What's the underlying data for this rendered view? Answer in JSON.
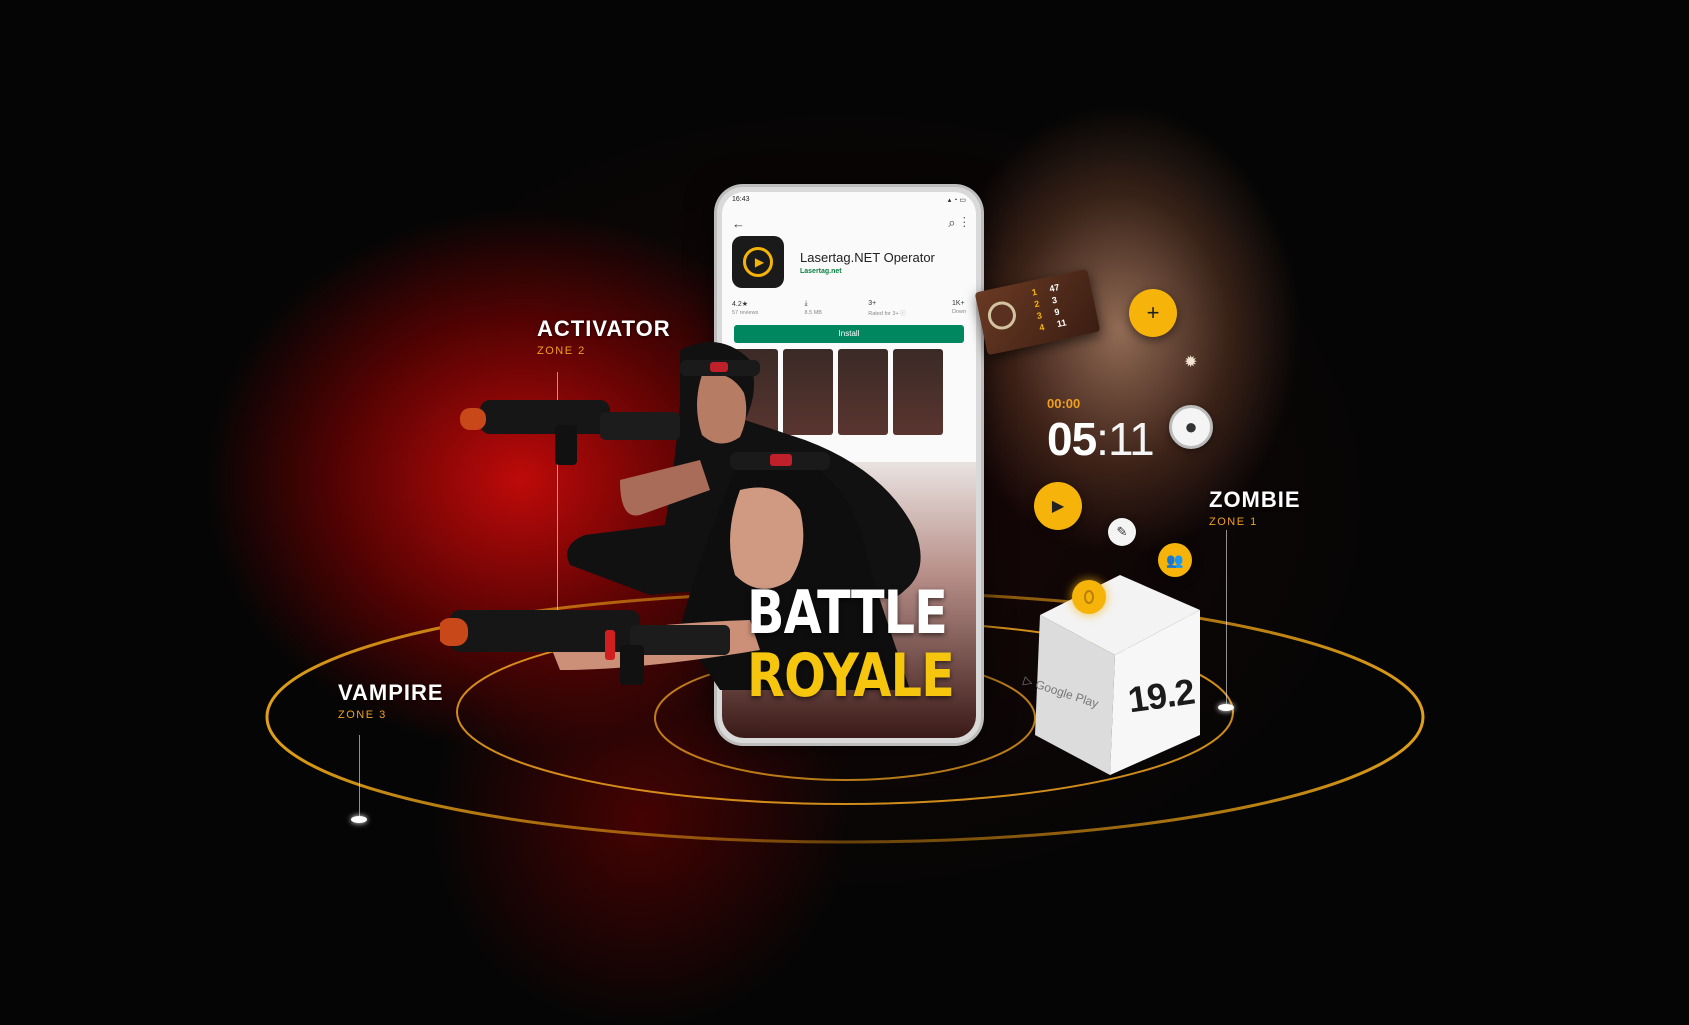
{
  "zones": {
    "activator": {
      "name": "ACTIVATOR",
      "sub": "ZONE 2"
    },
    "vampire": {
      "name": "VAMPIRE",
      "sub": "ZONE 3"
    },
    "zombie": {
      "name": "ZOMBIE",
      "sub": "ZONE 1"
    }
  },
  "phone": {
    "time": "16:43",
    "app_title": "Lasertag.NET Operator",
    "developer": "Lasertag.net",
    "stats": [
      {
        "value": "4.2★",
        "caption": "57 reviews"
      },
      {
        "value": "8.5 MB",
        "caption": ""
      },
      {
        "value": "3+",
        "caption": "Rated for 3+ ⓘ"
      },
      {
        "value": "1K+",
        "caption": "Down"
      }
    ],
    "install_label": "Install",
    "review_label": "review"
  },
  "headline": {
    "line1": "BATTLE",
    "line2": "ROYALE"
  },
  "timer": {
    "small": "00:00",
    "big_minutes": "05",
    "big_seconds": ":11"
  },
  "scorecard": {
    "rows": [
      {
        "a": "1",
        "b": "47"
      },
      {
        "a": "2",
        "b": "3"
      },
      {
        "a": "3",
        "b": "9"
      },
      {
        "a": "4",
        "b": "11"
      }
    ]
  },
  "cube": {
    "value": "19.2",
    "brand": "Google Play"
  },
  "colors": {
    "accent": "#f6b40b",
    "zone_sub": "#f0a020",
    "install_green": "#01875f"
  }
}
